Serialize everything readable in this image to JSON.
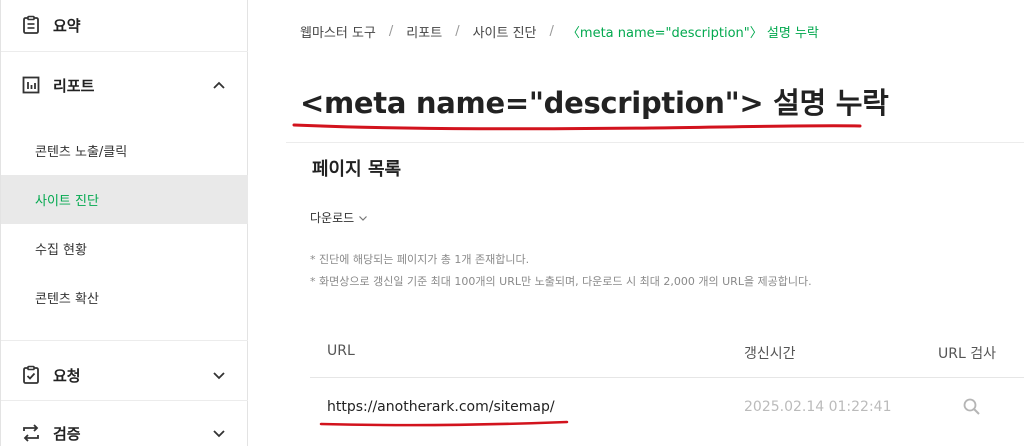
{
  "sidebar": {
    "summary": {
      "label": "요약",
      "icon": "clipboard-icon"
    },
    "report": {
      "label": "리포트",
      "icon": "bar-chart-icon",
      "expanded": true,
      "items": [
        {
          "label": "콘텐츠 노출/클릭",
          "active": false
        },
        {
          "label": "사이트 진단",
          "active": true
        },
        {
          "label": "수집 현황",
          "active": false
        },
        {
          "label": "콘텐츠 확산",
          "active": false
        }
      ]
    },
    "request": {
      "label": "요청",
      "icon": "clipboard-check-icon"
    },
    "verify": {
      "label": "검증",
      "icon": "repeat-icon"
    }
  },
  "breadcrumb": [
    "웹마스터 도구",
    "리포트",
    "사이트 진단",
    "〈meta name=\"description\"〉 설명 누락"
  ],
  "page": {
    "title": "<meta name=\"description\"> 설명 누락",
    "section_title": "페이지 목록",
    "download_label": "다운로드",
    "notes": [
      "* 진단에 해당되는 페이지가 총 1개 존재합니다.",
      "* 화면상으로 갱신일 기준 최대 100개의 URL만 노출되며, 다운로드 시 최대 2,000 개의 URL을 제공합니다."
    ]
  },
  "table": {
    "headers": [
      "URL",
      "갱신시간",
      "URL 검사"
    ],
    "rows": [
      {
        "url": "https://anotherark.com/sitemap/",
        "time": "2025.02.14 01:22:41"
      }
    ]
  },
  "colors": {
    "accent": "#03a94f",
    "annotation": "#d2131d",
    "active_bg": "#e9e9e9"
  }
}
